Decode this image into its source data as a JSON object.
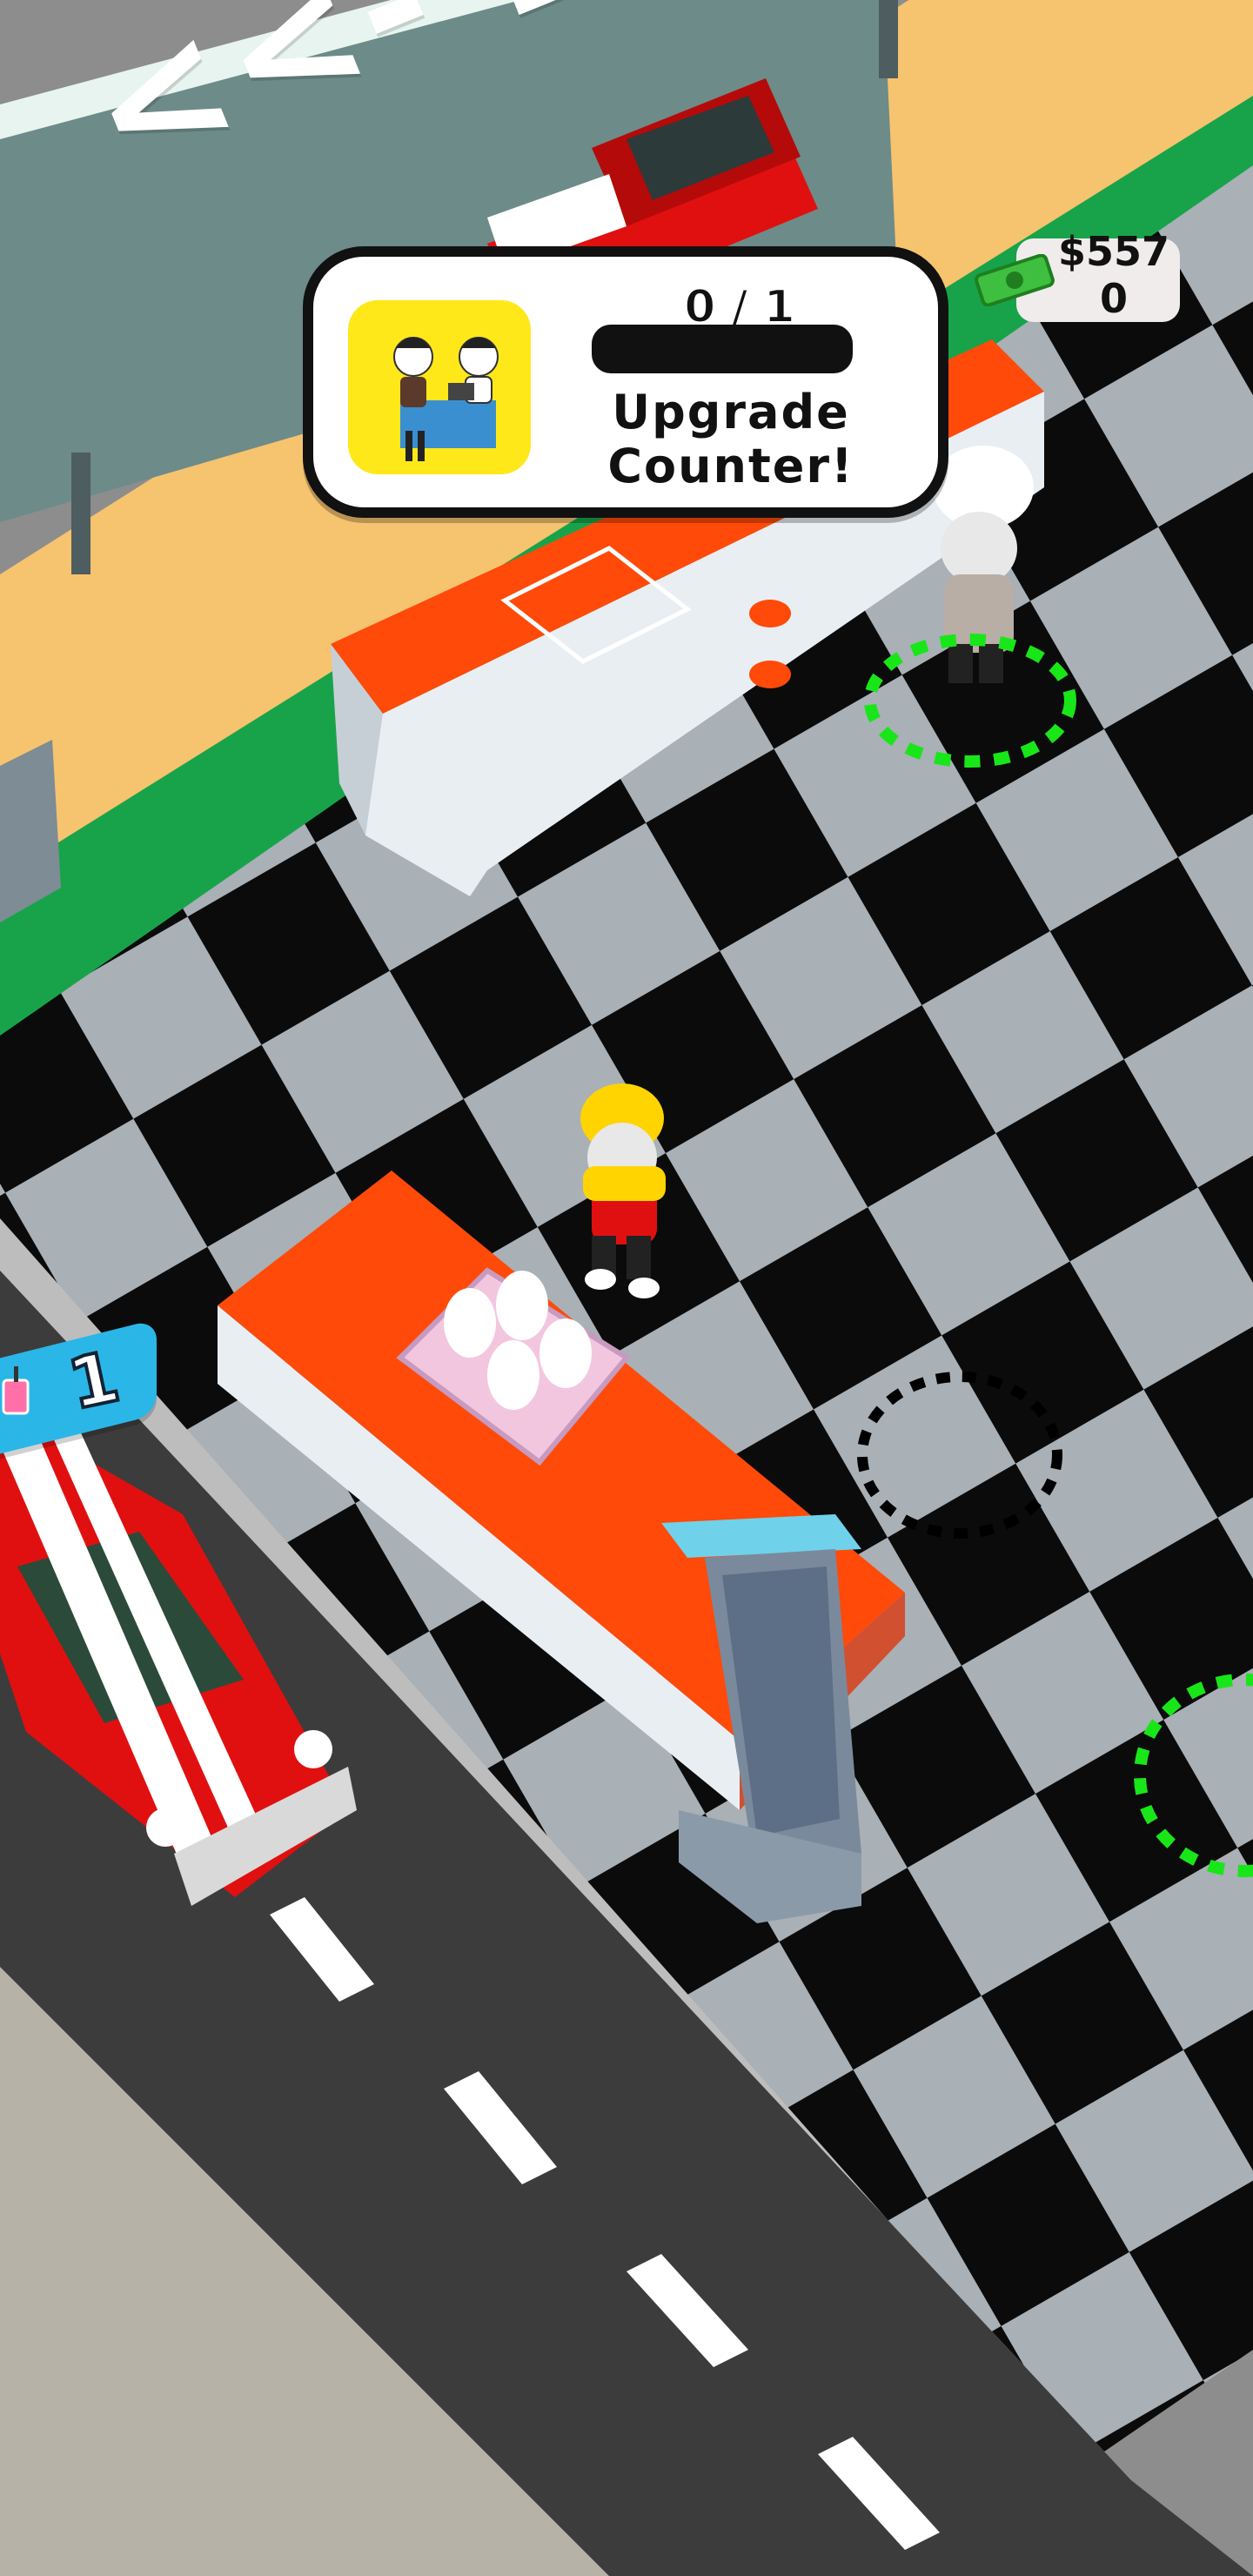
{
  "sign": {
    "text": "<<- Drive"
  },
  "task": {
    "progress_text": "0 / 1",
    "progress_fraction": 0,
    "title": "Upgrade\nCounter!",
    "icon": "cashier-workers-icon",
    "icon_bg": "#ffe81a"
  },
  "wallet": {
    "amount": "$557\n0",
    "icon": "cash-bill-icon"
  },
  "order_badge": {
    "count": "1",
    "icon": "milkshake-icon"
  },
  "colors": {
    "counter_orange": "#ff4a0a",
    "car_red": "#e01010",
    "circle_green": "#19e619",
    "badge_blue": "#2bb6e8"
  }
}
